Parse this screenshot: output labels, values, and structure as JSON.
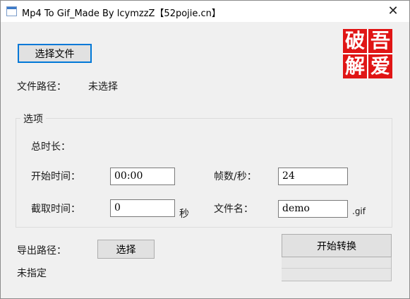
{
  "window": {
    "title": "Mp4 To Gif_Made By lcymzzZ【52pojie.cn】",
    "close_glyph": "✕"
  },
  "logo": {
    "chars": [
      "破",
      "吾",
      "解",
      "爱"
    ],
    "color": "#e01515"
  },
  "file": {
    "choose_button": "选择文件",
    "path_label": "文件路径：",
    "path_value": "未选择"
  },
  "options": {
    "title": "选项",
    "duration_label": "总时长：",
    "start_time_label": "开始时间：",
    "start_time_value": "00:00",
    "clip_time_label": "截取时间：",
    "clip_time_value": "0",
    "clip_time_unit": "秒",
    "fps_label": "帧数/秒：",
    "fps_value": "24",
    "filename_label": "文件名：",
    "filename_value": "demo",
    "filename_ext": ".gif"
  },
  "export": {
    "path_label": "导出路径：",
    "choose_button": "选择",
    "path_value": "未指定"
  },
  "convert": {
    "start_button": "开始转换",
    "progress_fraction": 0
  },
  "colors": {
    "accent": "#0078d7",
    "logo_red": "#e01515"
  }
}
